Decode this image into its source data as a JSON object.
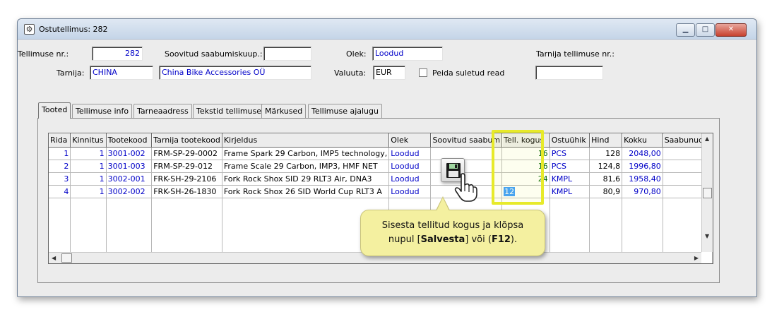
{
  "window": {
    "title": "Ostutellimus: 282",
    "app_icon": "gear-icon",
    "minimize_glyph": "▁",
    "maximize_glyph": "□",
    "close_glyph": "✕"
  },
  "form": {
    "order_no_label": "Tellimuse nr.:",
    "order_no_value": "282",
    "agreed_arrival_label": "Soovitud saabumiskuup.:",
    "agreed_arrival_value": "",
    "status_label": "Olek:",
    "status_value": "Loodud",
    "supplier_order_label": "Tarnija tellimuse nr.:",
    "supplier_order_value": "",
    "supplier_label": "Tarnija:",
    "supplier_code": "CHINA",
    "supplier_name": "China Bike Accessories OÜ",
    "currency_label": "Valuuta:",
    "currency_value": "EUR",
    "hide_closed_label": "Peida suletud read"
  },
  "tabs": [
    {
      "label": "Tooted",
      "active": true
    },
    {
      "label": "Tellimuse info",
      "active": false
    },
    {
      "label": "Tarneaadress",
      "active": false
    },
    {
      "label": "Tekstid tellimusel",
      "active": false
    },
    {
      "label": "Märkused",
      "active": false
    },
    {
      "label": "Tellimuse ajalugu",
      "active": false
    }
  ],
  "table": {
    "columns": [
      "Rida",
      "Kinnitus",
      "Tootekood",
      "Tarnija tootekood",
      "Kirjeldus",
      "Olek",
      "Soovitud saabum",
      "Tell. kogus",
      "Ostuühik",
      "Hind",
      "Kokku",
      "Saabunud k"
    ],
    "rows": [
      {
        "rida": "1",
        "kinnitus": "1",
        "tootekood": "3001-002",
        "tarnija_kood": "FRM-SP-29-0002",
        "kirjeldus": "Frame Spark 29 Carbon, IMP5 technology,",
        "olek": "Loodud",
        "soovitud": "",
        "kogus": "16",
        "uhik": "PCS",
        "hind": "128",
        "kokku": "2048,00",
        "saabunud": ""
      },
      {
        "rida": "2",
        "kinnitus": "1",
        "tootekood": "3001-003",
        "tarnija_kood": "FRM-SP-29-012",
        "kirjeldus": "Frame Scale 29 Carbon, IMP3, HMF NET",
        "olek": "Loodud",
        "soovitud": "",
        "kogus": "16",
        "uhik": "PCS",
        "hind": "124,8",
        "kokku": "1996,80",
        "saabunud": ""
      },
      {
        "rida": "3",
        "kinnitus": "1",
        "tootekood": "3002-001",
        "tarnija_kood": "FRK-SH-29-2106",
        "kirjeldus": "Fork Rock Shox SID 29 RLT3 Air, DNA3",
        "olek": "Loodud",
        "soovitud": "",
        "kogus": "24",
        "uhik": "KMPL",
        "hind": "81,6",
        "kokku": "1958,40",
        "saabunud": ""
      },
      {
        "rida": "4",
        "kinnitus": "1",
        "tootekood": "3002-002",
        "tarnija_kood": "FRK-SH-26-1830",
        "kirjeldus": "Fork Rock Shox 26 SID World Cup RLT3 A",
        "olek": "Loodud",
        "soovitud": "",
        "kogus": "12",
        "uhik": "KMPL",
        "hind": "80,9",
        "kokku": "970,80",
        "saabunud": ""
      }
    ]
  },
  "tooltip": {
    "line1": "Sisesta tellitud kogus ja klõpsa",
    "line2_prefix": "nupul [",
    "save_word": "Salvesta",
    "line2_middle": "] või (",
    "key": "F12",
    "line2_suffix": ")."
  },
  "icons": {
    "save": "floppy-disk-icon",
    "cursor": "hand-pointer-icon"
  },
  "colors": {
    "value_blue": "#0000c8",
    "qty_green": "#006400",
    "highlight_yellow": "#e7ea2a",
    "tooltip_bg": "#f4f0a0",
    "selection": "#3399ff"
  }
}
